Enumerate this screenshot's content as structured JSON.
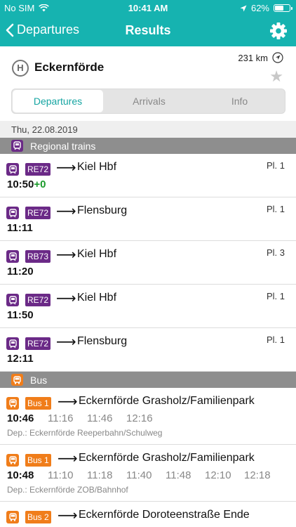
{
  "status_bar": {
    "carrier": "No SIM",
    "time": "10:41 AM",
    "battery_text": "62%",
    "battery_level": 0.62
  },
  "nav": {
    "back_label": "Departures",
    "title": "Results"
  },
  "station": {
    "type_symbol": "H",
    "name": "Eckernförde",
    "distance": "231 km"
  },
  "tabs": [
    {
      "label": "Departures",
      "active": true
    },
    {
      "label": "Arrivals",
      "active": false
    },
    {
      "label": "Info",
      "active": false
    }
  ],
  "date": "Thu, 22.08.2019",
  "sections": {
    "regional": {
      "label": "Regional trains",
      "color": "#6b2a87",
      "rows": [
        {
          "line": "RE72",
          "arrow": "⟶",
          "destination": "Kiel Hbf",
          "platform": "Pl. 1",
          "time": "10:50",
          "delay": "+0"
        },
        {
          "line": "RE72",
          "arrow": "⟶",
          "destination": "Flensburg",
          "platform": "Pl. 1",
          "time": "11:11"
        },
        {
          "line": "RB73",
          "arrow": "⟶",
          "destination": "Kiel Hbf",
          "platform": "Pl. 3",
          "time": "11:20"
        },
        {
          "line": "RE72",
          "arrow": "⟶",
          "destination": "Kiel Hbf",
          "platform": "Pl. 1",
          "time": "11:50"
        },
        {
          "line": "RE72",
          "arrow": "⟶",
          "destination": "Flensburg",
          "platform": "Pl. 1",
          "time": "12:11"
        }
      ]
    },
    "bus": {
      "label": "Bus",
      "color": "#f07d1a",
      "rows": [
        {
          "line": "Bus 1",
          "arrow": "⟶",
          "destination": "Eckernförde Grasholz/Familienpark",
          "time": "10:46",
          "later_times": [
            "11:16",
            "11:46",
            "12:16"
          ],
          "stop": "Dep.: Eckernförde Reeperbahn/Schulweg"
        },
        {
          "line": "Bus 1",
          "arrow": "⟶",
          "destination": "Eckernförde Grasholz/Familienpark",
          "time": "10:48",
          "later_times": [
            "11:10",
            "11:18",
            "11:40",
            "11:48",
            "12:10",
            "12:18"
          ],
          "stop": "Dep.: Eckernförde ZOB/Bahnhof"
        },
        {
          "line": "Bus 2",
          "arrow": "⟶",
          "destination": "Eckernförde Doroteenstraße Ende"
        }
      ]
    }
  },
  "colors": {
    "header": "#16b3b0",
    "accent": "#16a5a2",
    "train": "#6b2a87",
    "bus": "#f07d1a",
    "delay": "#1a9a2a"
  }
}
